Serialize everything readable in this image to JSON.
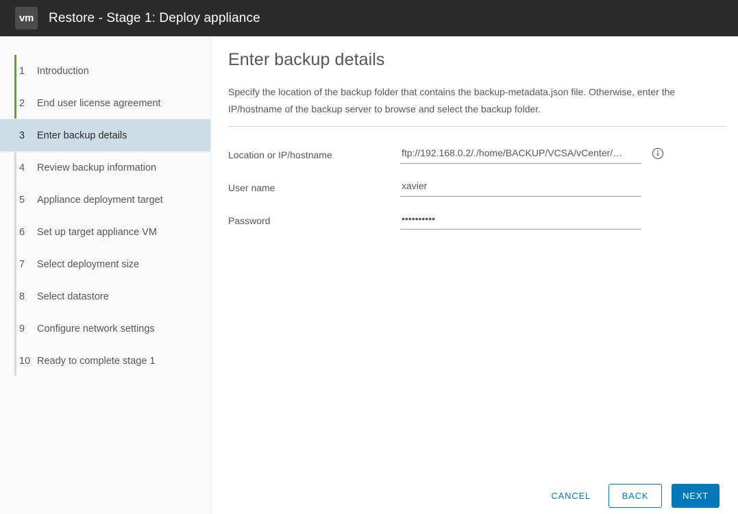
{
  "titlebar": {
    "logo_text": "vm",
    "title": "Restore - Stage 1: Deploy appliance"
  },
  "sidebar": {
    "steps": [
      {
        "num": "1",
        "label": "Introduction",
        "state": "done"
      },
      {
        "num": "2",
        "label": "End user license agreement",
        "state": "done"
      },
      {
        "num": "3",
        "label": "Enter backup details",
        "state": "active"
      },
      {
        "num": "4",
        "label": "Review backup information",
        "state": "pending"
      },
      {
        "num": "5",
        "label": "Appliance deployment target",
        "state": "pending"
      },
      {
        "num": "6",
        "label": "Set up target appliance VM",
        "state": "pending"
      },
      {
        "num": "7",
        "label": "Select deployment size",
        "state": "pending"
      },
      {
        "num": "8",
        "label": "Select datastore",
        "state": "pending"
      },
      {
        "num": "9",
        "label": "Configure network settings",
        "state": "pending"
      },
      {
        "num": "10",
        "label": "Ready to complete stage 1",
        "state": "pending"
      }
    ]
  },
  "main": {
    "title": "Enter backup details",
    "description": "Specify the location of the backup folder that contains the backup-metadata.json file. Otherwise, enter the IP/hostname of the backup server to browse and select the backup folder.",
    "fields": [
      {
        "label": "Location or IP/hostname",
        "value": "ftp://192.168.0.2/./home/BACKUP/VCSA/vCenter/…",
        "placeholder": "",
        "type": "text",
        "has_info": true
      },
      {
        "label": "User name",
        "value": "xavier",
        "placeholder": "",
        "type": "text",
        "has_info": false
      },
      {
        "label": "Password",
        "value": "••••••••••",
        "placeholder": "",
        "type": "password",
        "has_info": false
      }
    ]
  },
  "footer": {
    "cancel_label": "CANCEL",
    "back_label": "BACK",
    "next_label": "NEXT"
  },
  "colors": {
    "header_bg": "#2b2b2b",
    "progress_done": "#62a420",
    "active_step_bg": "#ccdde5",
    "accent_blue": "#0079b8"
  }
}
